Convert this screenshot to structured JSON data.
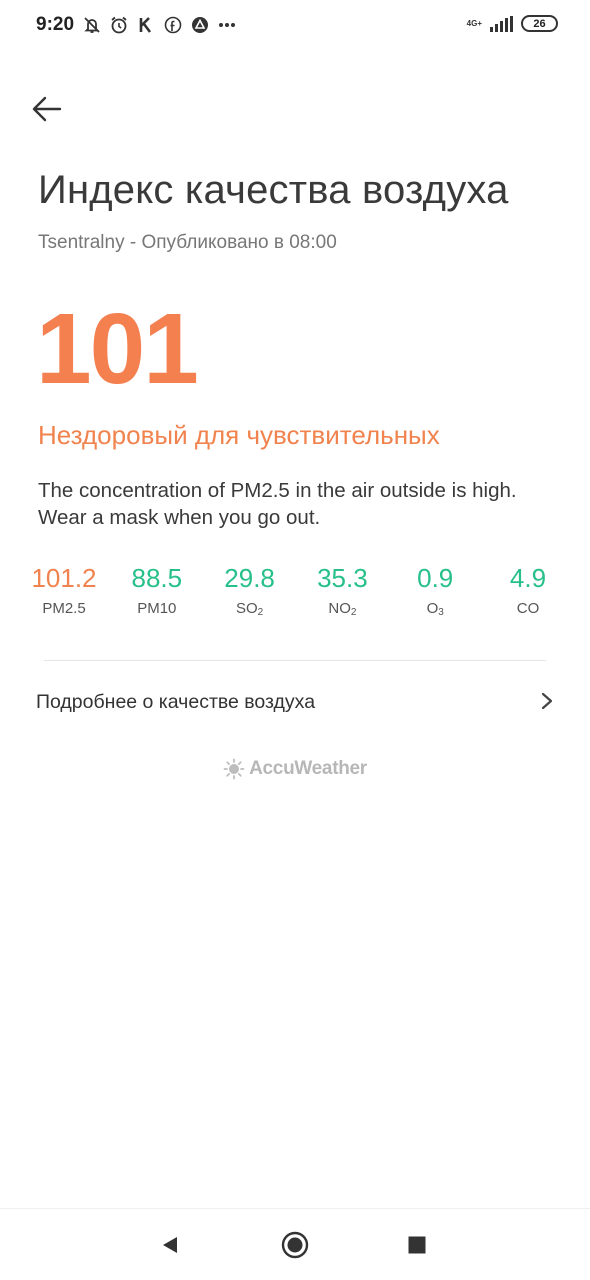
{
  "status_bar": {
    "time": "9:20",
    "network": "4G+",
    "battery": "26",
    "left_icons": [
      "muted-bell-icon",
      "alarm-icon",
      "k-app-icon",
      "facebook-icon",
      "app-triangle-icon",
      "more-dots-icon"
    ]
  },
  "header": {
    "title": "Индекс качества воздуха",
    "subtitle": "Tsentralny - Опубликовано в 08:00"
  },
  "aqi": {
    "value": "101",
    "category": "Нездоровый для чувствительных",
    "description": "The concentration of PM2.5 in the air outside is high. Wear a mask when you go out.",
    "accent_color": "#f47f4f"
  },
  "pollutants": [
    {
      "value": "101.2",
      "name": "PM",
      "sub": "2.5",
      "inline_label": "PM2.5",
      "color": "#f0834e"
    },
    {
      "value": "88.5",
      "name": "PM10",
      "sub": "",
      "color": "#27c08a"
    },
    {
      "value": "29.8",
      "name": "SO",
      "sub": "2",
      "color": "#27c08a"
    },
    {
      "value": "35.3",
      "name": "NO",
      "sub": "2",
      "color": "#27c08a"
    },
    {
      "value": "0.9",
      "name": "O",
      "sub": "3",
      "color": "#27c08a"
    },
    {
      "value": "4.9",
      "name": "CO",
      "sub": "",
      "color": "#27c08a"
    }
  ],
  "more_link": {
    "label": "Подробнее о качестве воздуха"
  },
  "provider": {
    "name": "AccuWeather"
  },
  "colors": {
    "unhealthy_sensitive": "#f47f4f",
    "good": "#27c08a"
  }
}
